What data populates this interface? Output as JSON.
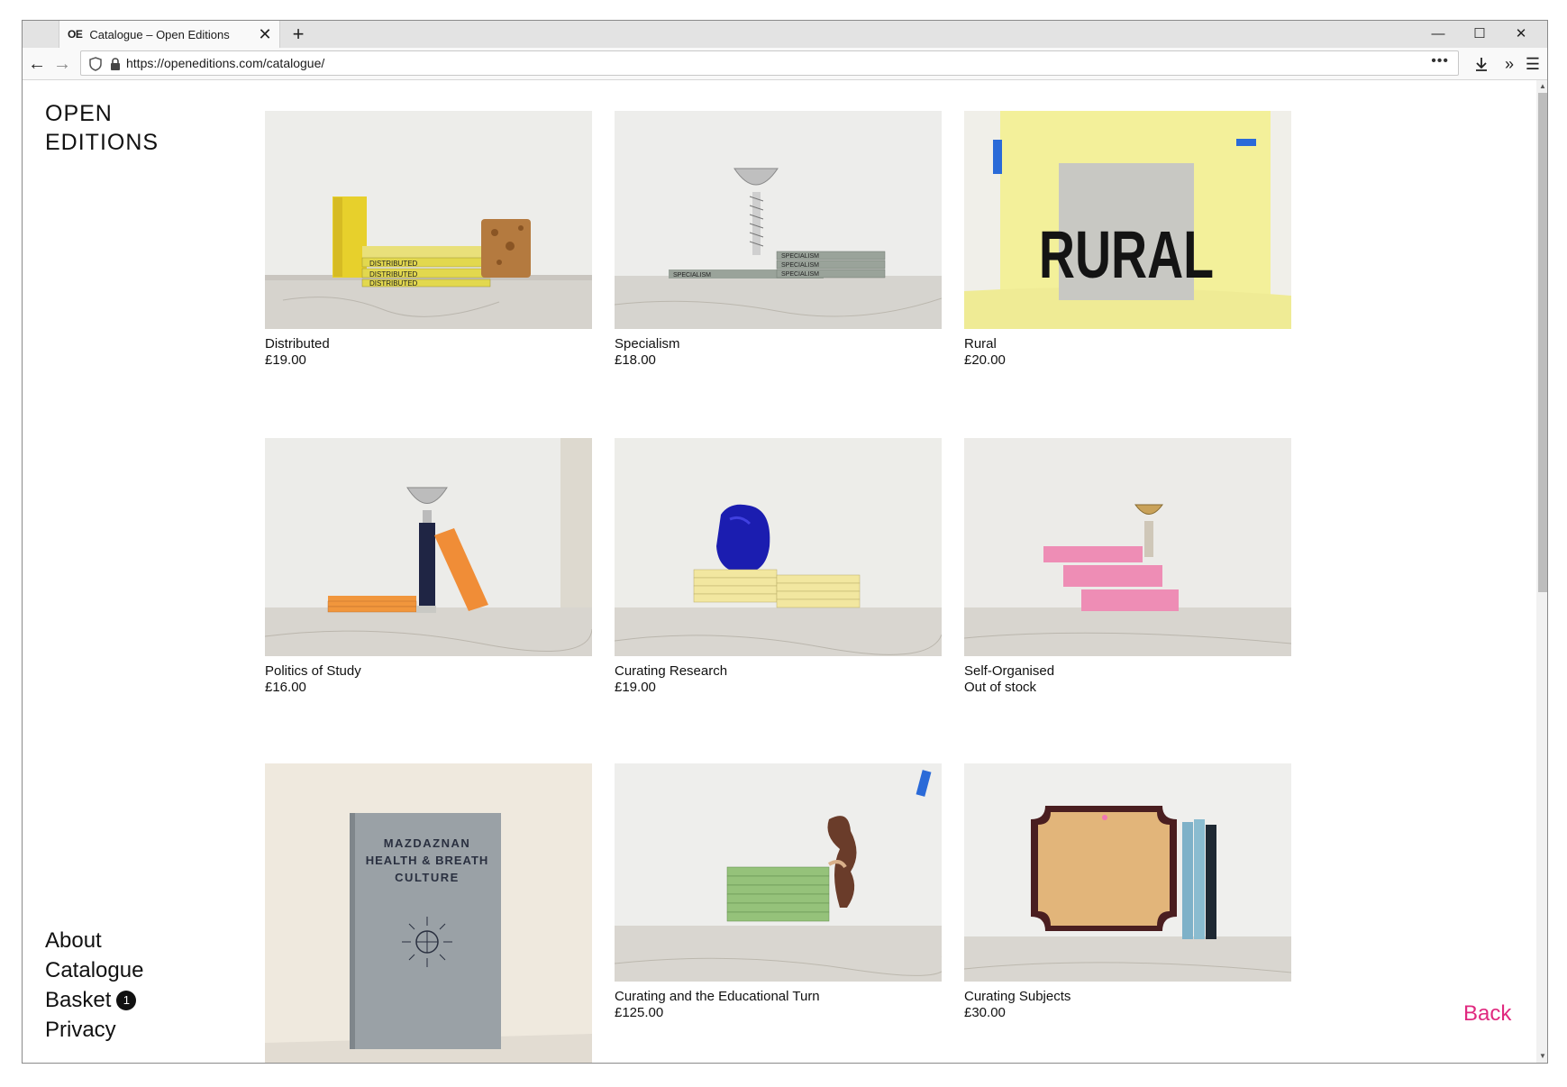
{
  "browser": {
    "tab_favicon": "OE",
    "tab_title": "Catalogue – Open Editions",
    "tab_close": "✕",
    "new_tab": "+",
    "url": "https://openeditions.com/catalogue/",
    "url_actions": "•••"
  },
  "site": {
    "logo_line1": "OPEN",
    "logo_line2": "EDITIONS"
  },
  "nav": {
    "about": "About",
    "catalogue": "Catalogue",
    "basket": "Basket",
    "basket_count": "1",
    "privacy": "Privacy",
    "back": "Back"
  },
  "products": [
    {
      "name": "Distributed",
      "price": "£19.00"
    },
    {
      "name": "Specialism",
      "price": "£18.00"
    },
    {
      "name": "Rural",
      "price": "£20.00"
    },
    {
      "name": "Politics of Study",
      "price": "£16.00"
    },
    {
      "name": "Curating Research",
      "price": "£19.00"
    },
    {
      "name": "Self-Organised",
      "price": "Out of stock"
    },
    {
      "name": "",
      "price": ""
    },
    {
      "name": "Curating and the Educational Turn",
      "price": "£125.00"
    },
    {
      "name": "Curating Subjects",
      "price": "£30.00"
    }
  ],
  "image_text": {
    "rural_cover": "RURAL",
    "mazdaznan_line1": "MAZDAZNAN",
    "mazdaznan_line2": "HEALTH & BREATH",
    "mazdaznan_line3": "CULTURE"
  },
  "colors": {
    "accent_back": "#e0297f",
    "text": "#111111"
  }
}
